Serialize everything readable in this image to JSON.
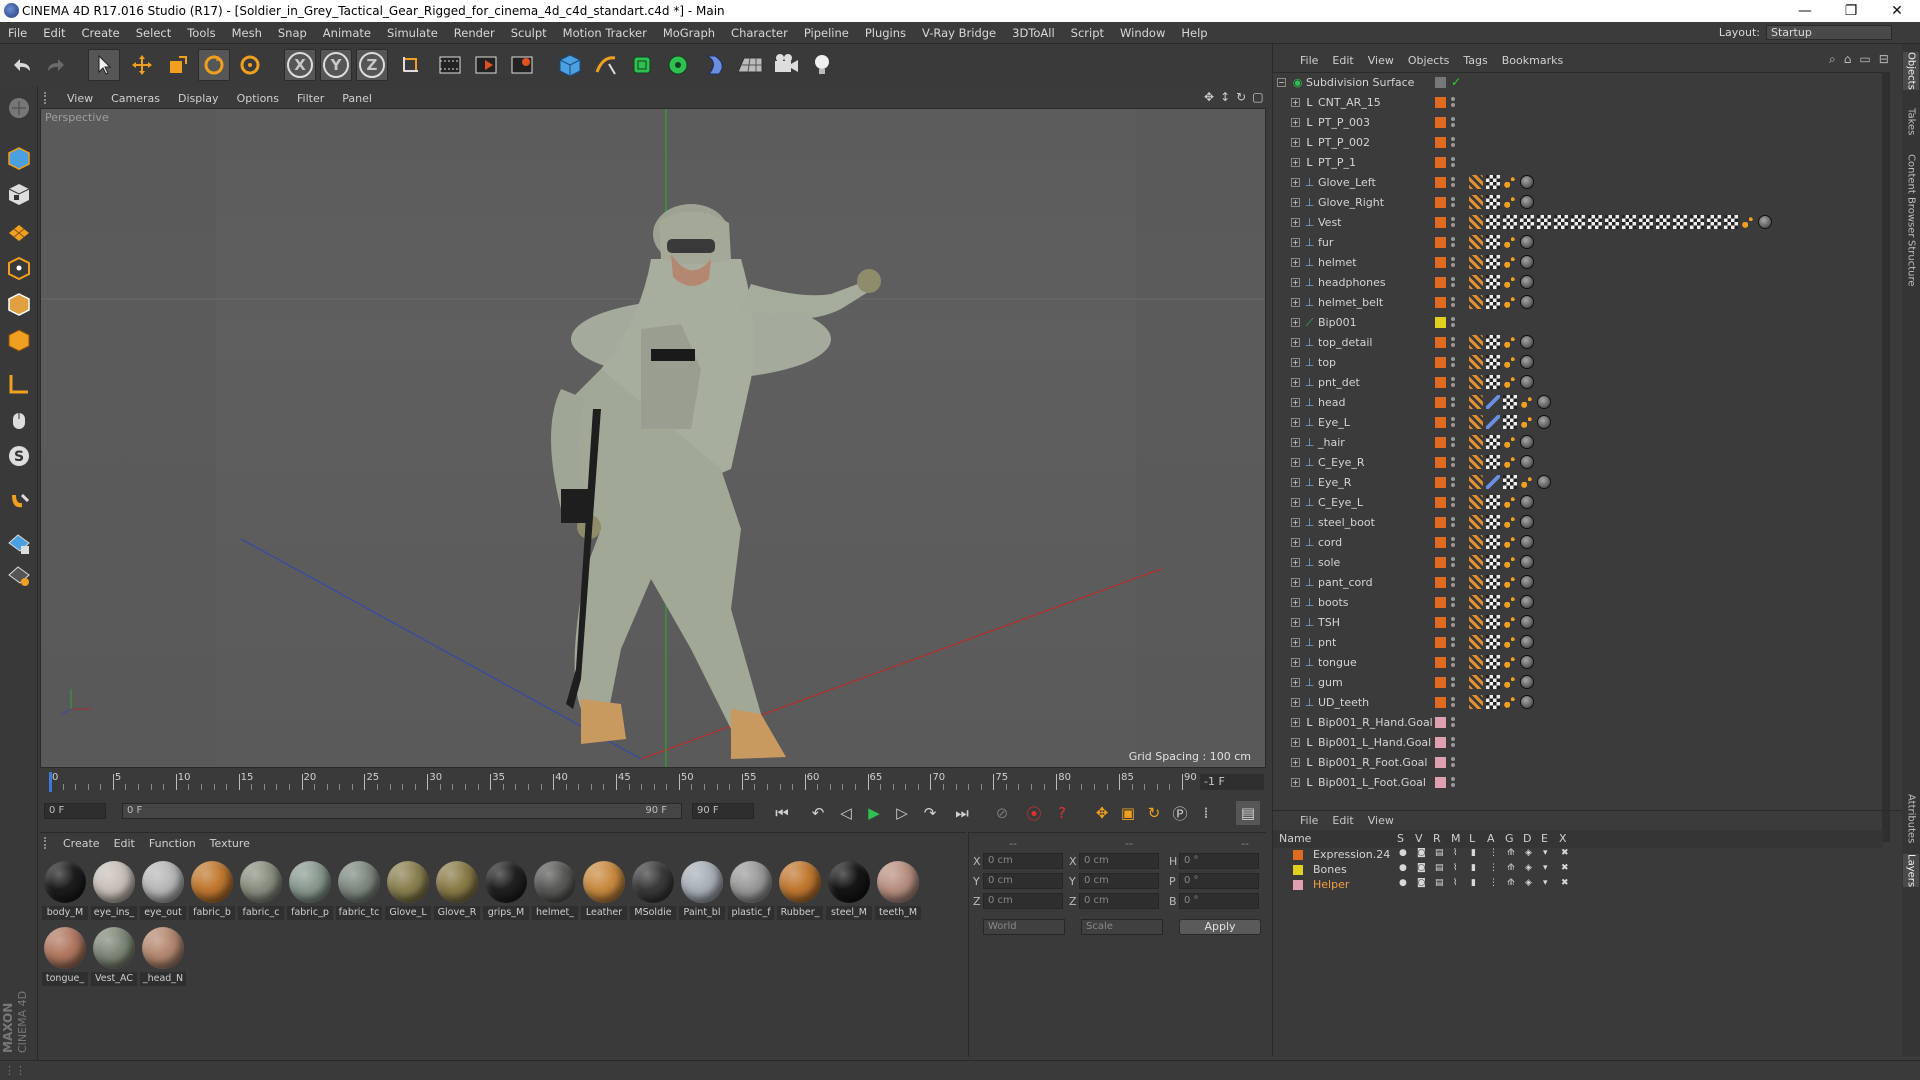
{
  "window": {
    "title": "CINEMA 4D R17.016 Studio (R17) - [Soldier_in_Grey_Tactical_Gear_Rigged_for_cinema_4d_c4d_standart.c4d *] - Main",
    "minimize": "—",
    "maximize": "❐",
    "close": "✕"
  },
  "menubar": [
    "File",
    "Edit",
    "Create",
    "Select",
    "Tools",
    "Mesh",
    "Snap",
    "Animate",
    "Simulate",
    "Render",
    "Sculpt",
    "Motion Tracker",
    "MoGraph",
    "Character",
    "Pipeline",
    "Plugins",
    "V-Ray Bridge",
    "3DToAll",
    "Script",
    "Window",
    "Help"
  ],
  "layout": {
    "label": "Layout:",
    "value": "Startup"
  },
  "toolbar": {
    "axis_x": "X",
    "axis_y": "Y",
    "axis_z": "Z"
  },
  "viewport": {
    "menu": [
      "View",
      "Cameras",
      "Display",
      "Options",
      "Filter",
      "Panel"
    ],
    "camera_label": "Perspective",
    "grid_spacing": "Grid Spacing : 100 cm"
  },
  "timeline": {
    "ticks": [
      "0",
      "5",
      "10",
      "15",
      "20",
      "25",
      "30",
      "35",
      "40",
      "45",
      "50",
      "55",
      "60",
      "65",
      "70",
      "75",
      "80",
      "85",
      "90"
    ],
    "current_frame_label": "-1 F"
  },
  "transport": {
    "start_field": "0 F",
    "range_start": "0 F",
    "range_end": "90 F",
    "end_field": "90 F"
  },
  "material_manager": {
    "menu": [
      "Create",
      "Edit",
      "Function",
      "Texture"
    ],
    "materials": [
      {
        "label": "body_M",
        "color": "#1c1c1c"
      },
      {
        "label": "eye_ins_",
        "color": "#c8c0b8"
      },
      {
        "label": "eye_out",
        "color": "#b8b8b8"
      },
      {
        "label": "fabric_b",
        "color": "#c07830"
      },
      {
        "label": "fabric_c",
        "color": "#8a9080"
      },
      {
        "label": "fabric_p",
        "color": "#8a9a90"
      },
      {
        "label": "fabric_tc",
        "color": "#7e8a80"
      },
      {
        "label": "Glove_L",
        "color": "#8a8050"
      },
      {
        "label": "Glove_R",
        "color": "#8a7c48"
      },
      {
        "label": "grips_M",
        "color": "#202020"
      },
      {
        "label": "helmet_",
        "color": "#5a5a58"
      },
      {
        "label": "Leather",
        "color": "#c88a40"
      },
      {
        "label": "MSoldie",
        "color": "#3a3a3a"
      },
      {
        "label": "Paint_bl",
        "color": "#a8b0b8"
      },
      {
        "label": "plastic_f",
        "color": "#9a9a9a"
      },
      {
        "label": "Rubber_",
        "color": "#c07830"
      },
      {
        "label": "steel_M",
        "color": "#151515"
      },
      {
        "label": "teeth_M",
        "color": "#b89080"
      },
      {
        "label": "tongue_",
        "color": "#b07860"
      },
      {
        "label": "Vest_AC",
        "color": "#7e8878"
      },
      {
        "label": "_head_N",
        "color": "#b48870"
      }
    ]
  },
  "coordinates": {
    "header": [
      "--",
      "--",
      "--"
    ],
    "rows": [
      {
        "a": "X",
        "v1": "0 cm",
        "b": "X",
        "v2": "0 cm",
        "c": "H",
        "v3": "0 °"
      },
      {
        "a": "Y",
        "v1": "0 cm",
        "b": "Y",
        "v2": "0 cm",
        "c": "P",
        "v3": "0 °"
      },
      {
        "a": "Z",
        "v1": "0 cm",
        "b": "Z",
        "v2": "0 cm",
        "c": "B",
        "v3": "0 °"
      }
    ],
    "world": "World",
    "scale": "Scale",
    "apply": "Apply"
  },
  "object_manager": {
    "menu": [
      "File",
      "Edit",
      "View",
      "Objects",
      "Tags",
      "Bookmarks"
    ],
    "root": "Subdivision Surface",
    "objects": [
      {
        "name": "CNT_AR_15",
        "kind": "null",
        "color": "#e06a20",
        "tags": ""
      },
      {
        "name": "PT_P_003",
        "kind": "null",
        "color": "#e06a20",
        "tags": ""
      },
      {
        "name": "PT_P_002",
        "kind": "null",
        "color": "#e06a20",
        "tags": ""
      },
      {
        "name": "PT_P_1",
        "kind": "null",
        "color": "#e06a20",
        "tags": ""
      },
      {
        "name": "Glove_Left",
        "kind": "mesh",
        "color": "#e06a20",
        "tags": "pcdm"
      },
      {
        "name": "Glove_Right",
        "kind": "mesh",
        "color": "#e06a20",
        "tags": "pcdm"
      },
      {
        "name": "Vest",
        "kind": "mesh",
        "color": "#e06a20",
        "tags": "pcccccccccccccccdm"
      },
      {
        "name": "fur",
        "kind": "mesh",
        "color": "#e06a20",
        "tags": "pcdm"
      },
      {
        "name": "helmet",
        "kind": "mesh",
        "color": "#e06a20",
        "tags": "pcdm"
      },
      {
        "name": "headphones",
        "kind": "mesh",
        "color": "#e06a20",
        "tags": "pcdm"
      },
      {
        "name": "helmet_belt",
        "kind": "mesh",
        "color": "#e06a20",
        "tags": "pcdm"
      },
      {
        "name": "Bip001",
        "kind": "bone",
        "color": "#e0d020",
        "tags": ""
      },
      {
        "name": "top_detail",
        "kind": "mesh",
        "color": "#e06a20",
        "tags": "pcdm"
      },
      {
        "name": "top",
        "kind": "mesh",
        "color": "#e06a20",
        "tags": "pcdm"
      },
      {
        "name": "pnt_det",
        "kind": "mesh",
        "color": "#e06a20",
        "tags": "pcdm"
      },
      {
        "name": "head",
        "kind": "mesh",
        "color": "#e06a20",
        "tags": "pkcdm"
      },
      {
        "name": "Eye_L",
        "kind": "mesh",
        "color": "#e06a20",
        "tags": "pkcdm"
      },
      {
        "name": "_hair",
        "kind": "mesh",
        "color": "#e06a20",
        "tags": "pcdm"
      },
      {
        "name": "C_Eye_R",
        "kind": "mesh",
        "color": "#e06a20",
        "tags": "pcdm"
      },
      {
        "name": "Eye_R",
        "kind": "mesh",
        "color": "#e06a20",
        "tags": "pkcdm"
      },
      {
        "name": "C_Eye_L",
        "kind": "mesh",
        "color": "#e06a20",
        "tags": "pcdm"
      },
      {
        "name": "steel_boot",
        "kind": "mesh",
        "color": "#e06a20",
        "tags": "pcdm"
      },
      {
        "name": "cord",
        "kind": "mesh",
        "color": "#e06a20",
        "tags": "pcdm"
      },
      {
        "name": "sole",
        "kind": "mesh",
        "color": "#e06a20",
        "tags": "pcdm"
      },
      {
        "name": "pant_cord",
        "kind": "mesh",
        "color": "#e06a20",
        "tags": "pcdm"
      },
      {
        "name": "boots",
        "kind": "mesh",
        "color": "#e06a20",
        "tags": "pcdm"
      },
      {
        "name": "TSH",
        "kind": "mesh",
        "color": "#e06a20",
        "tags": "pcdm"
      },
      {
        "name": "pnt",
        "kind": "mesh",
        "color": "#e06a20",
        "tags": "pcdm"
      },
      {
        "name": "tongue",
        "kind": "mesh",
        "color": "#e06a20",
        "tags": "pcdm"
      },
      {
        "name": "gum",
        "kind": "mesh",
        "color": "#e06a20",
        "tags": "pcdm"
      },
      {
        "name": "UD_teeth",
        "kind": "mesh",
        "color": "#e06a20",
        "tags": "pcdm"
      },
      {
        "name": "Bip001_R_Hand.Goal",
        "kind": "null",
        "color": "#e0a0b0",
        "tags": ""
      },
      {
        "name": "Bip001_L_Hand.Goal",
        "kind": "null",
        "color": "#e0a0b0",
        "tags": ""
      },
      {
        "name": "Bip001_R_Foot.Goal",
        "kind": "null",
        "color": "#e0a0b0",
        "tags": ""
      },
      {
        "name": "Bip001_L_Foot.Goal",
        "kind": "null",
        "color": "#e0a0b0",
        "tags": ""
      }
    ]
  },
  "layers": {
    "menu": [
      "File",
      "Edit",
      "View"
    ],
    "header_name": "Name",
    "header_cols": [
      "S",
      "V",
      "R",
      "M",
      "L",
      "A",
      "G",
      "D",
      "E",
      "X"
    ],
    "items": [
      {
        "name": "Expression.24",
        "color": "#e06a20",
        "text_color": "#d4d4d4"
      },
      {
        "name": "Bones",
        "color": "#e0d020",
        "text_color": "#d4d4d4"
      },
      {
        "name": "Helper",
        "color": "#e0a0b0",
        "text_color": "#f0a040"
      }
    ]
  },
  "right_tabs": [
    "Objects",
    "Takes",
    "Content Browser",
    "Structure",
    "Attributes",
    "Layers"
  ],
  "branding": {
    "maxon": "MAXON",
    "product": "CINEMA 4D"
  }
}
